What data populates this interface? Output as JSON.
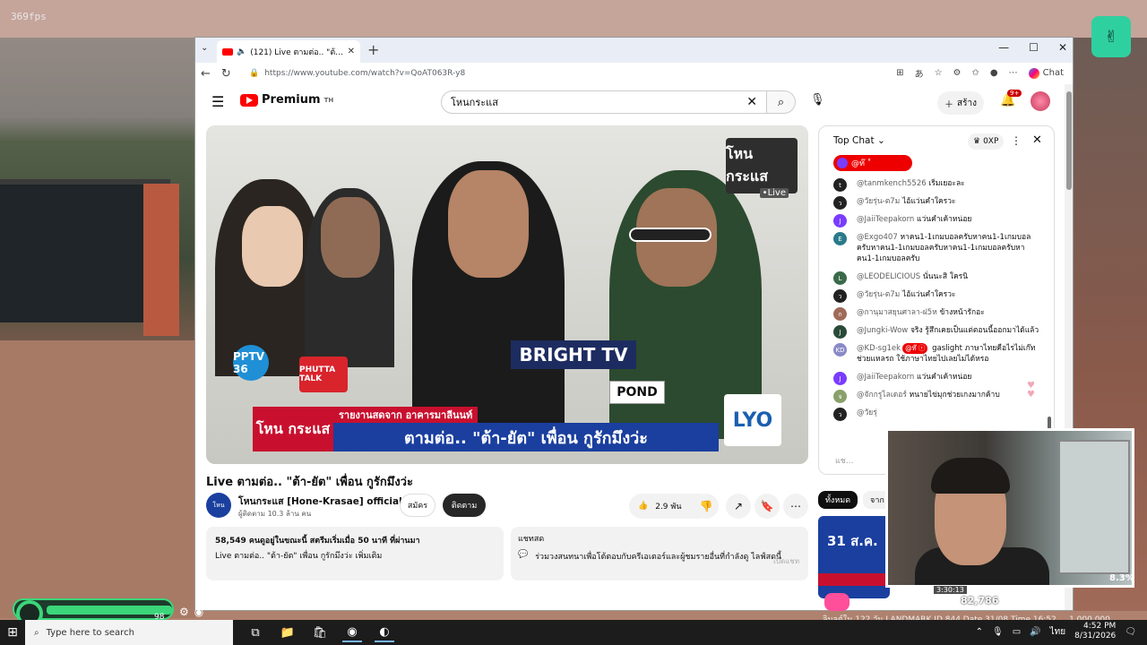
{
  "game": {
    "fps": "369fps",
    "hud_value": "98",
    "footer": "ลิมุลต์ใน 122 วัน  LANDMARK  ID 844  Date 31/08  Time 16:52 ...  1,000,000"
  },
  "browser": {
    "tab_label": "(121) Live ตามต่อ.. \"ต้า-ยัต\" เพื่อ...",
    "tab_close": "✕",
    "new_tab": "+",
    "url": "https://www.youtube.com/watch?v=QoAT063R-y8",
    "chat_button": "Chat",
    "window_controls": [
      "—",
      "☐",
      "✕"
    ]
  },
  "youtube": {
    "logo": "Premium",
    "logo_sup": "TH",
    "search_value": "โหนกระแส",
    "create_label": "สร้าง",
    "notifications": "9+"
  },
  "video": {
    "channel_bug": "โหน กระแส",
    "bug_live": "•Live",
    "brand_bright": "BRIGHT TV",
    "brand_pond": "POND",
    "brand_phutta": "PHUTTA TALK",
    "brand_pptv": "PPTV 36",
    "lower_label": "รายงานสดจาก อาคารมาลีนนท์",
    "lower_main": "ตามต่อ.. \"ต้า-ยัต\" เพื่อน กูรักมึงว่ะ",
    "lower_logo": "โหน กระแส",
    "lyo": "LYO",
    "title": "Live ตามต่อ.. \"ต้า-ยัต\" เพื่อน กูรักมึงว่ะ"
  },
  "channel": {
    "avatar_text": "โหน",
    "name": "โหนกระแส [Hone-Krasae] official ◉",
    "subs": "ผู้ติดตาม 10.3 ล้าน คน",
    "join": "สมัคร",
    "subscribed": "ติดตาม",
    "likes": "2.9 พัน"
  },
  "description": {
    "line1": "58,549 คนดูอยู่ในขณะนี้  สตรีมเริ่มเมื่อ 50 นาที ที่ผ่านมา",
    "line2": "Live ตามต่อ.. \"ต้า-ยัต\" เพื่อน กูรักมึงว่ะ  เพิ่มเติม"
  },
  "live_chat_box": {
    "title": "แชทสด",
    "text": "ร่วมวงสนทนาเพื่อโต้ตอบกับครีเอเตอร์และผู้ชมรายอื่นที่กำลังดู ไลฟ์สดนี้",
    "open": "เปิดแชท"
  },
  "chat": {
    "header": "Top Chat",
    "xp": "0XP",
    "pinned": "@ท๊ ˚",
    "input_placeholder": "แช...",
    "messages": [
      {
        "author": "@tanmkench5526",
        "text": "เริ่มเยอะละ",
        "initial": "t"
      },
      {
        "author": "@วัยรุ่น-ต7ม",
        "text": "ไอ้แว่นคำใครวะ",
        "initial": "ว"
      },
      {
        "author": "@JaiiTeepakorn",
        "text": "แว่นคำเค้าหน่อย",
        "initial": "J"
      },
      {
        "author": "@Exgo407",
        "text": "หาคน1-1เกมบอลครับหาคน1-1เกมบอลครับหาคน1-1เกมบอลครับหาคน1-1เกมบอลครับหาคน1-1เกมบอลครับ",
        "initial": "E"
      },
      {
        "author": "@LEODELICIOUS",
        "text": "นั่นนะสิ ใครนิ",
        "initial": "L"
      },
      {
        "author": "@วัยรุ่น-ต7ม",
        "text": "ไอ้แว่นคำใครวะ",
        "initial": "ว"
      },
      {
        "author": "@กานุมาสยุนศาลา-ฝ5ห",
        "text": "ข้างหน้ารักอะ",
        "initial": "ก"
      },
      {
        "author": "@Jungki-Wow",
        "text": "จริง รู้สึกเคยเป็นแต่ตอนนี้ออกมาได้แล้ว",
        "initial": "J"
      },
      {
        "author": "@KD-sg1ek",
        "tag": "@ท๊ ⓡ",
        "text": "gaslight ภาษาไทยคือไรไม่เก๊ท ช่วยแหลรถ ใช้ภาษาไทยไปเลยไม่ได้หรอ",
        "initial": "KD"
      },
      {
        "author": "@JaiiTeepakorn",
        "text": "แว่นคำเค้าหน่อย",
        "initial": "J"
      },
      {
        "author": "@จักกรูไลเดอร์",
        "text": "หนายไข่มุกช่วยเกงมากค้าบ",
        "initial": "จ"
      },
      {
        "author": "@วัยรุ่",
        "text": "",
        "initial": "ว"
      }
    ]
  },
  "chips": [
    "ทั้งหมด",
    "จาก"
  ],
  "recommendation": {
    "date": "31 ส.ค.",
    "duration": "3:30:13"
  },
  "overlay": {
    "percent": "8.3%",
    "viewers": "82,786"
  },
  "taskbar": {
    "search_placeholder": "Type here to search",
    "time": "4:52 PM",
    "date": "8/31/2026"
  }
}
